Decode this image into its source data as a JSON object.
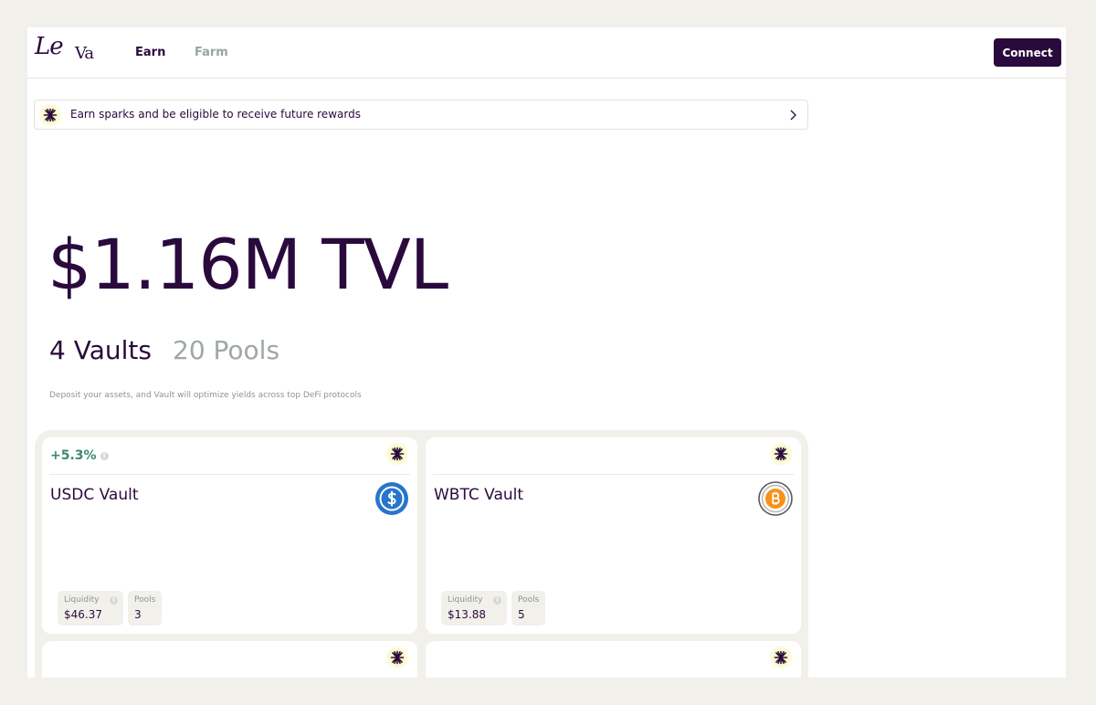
{
  "header": {
    "logo_line1": "Le",
    "logo_line2": "Va",
    "nav": [
      {
        "label": "Earn",
        "active": true
      },
      {
        "label": "Farm",
        "active": false
      }
    ],
    "connect_label": "Connect"
  },
  "banner": {
    "icon": "spark-icon",
    "text": "Earn sparks and be eligible to receive future rewards",
    "chevron": "chevron-right-icon"
  },
  "hero": {
    "tvl": "$1.16M TVL",
    "vaults": "4 Vaults",
    "pools": "20 Pools",
    "subtitle": "Deposit your assets, and Vault will optimize yields across top DeFi protocols"
  },
  "vaults": [
    {
      "apy": "+5.3%",
      "name": "USDC Vault",
      "token_icon": "usdc-icon",
      "liquidity_label": "Liquidity",
      "liquidity": "$46.37",
      "pools_label": "Pools",
      "pools": "3"
    },
    {
      "apy": "",
      "name": "WBTC Vault",
      "token_icon": "bitcoin-icon",
      "liquidity_label": "Liquidity",
      "liquidity": "$13.88",
      "pools_label": "Pools",
      "pools": "5"
    }
  ],
  "colors": {
    "brand": "#2a0a3d",
    "apy_green": "#3d8a6b",
    "muted": "#9fa8a3",
    "usdc_blue": "#2775ca",
    "btc_orange": "#f7931a",
    "spark_glow": "#f6f2a8"
  }
}
